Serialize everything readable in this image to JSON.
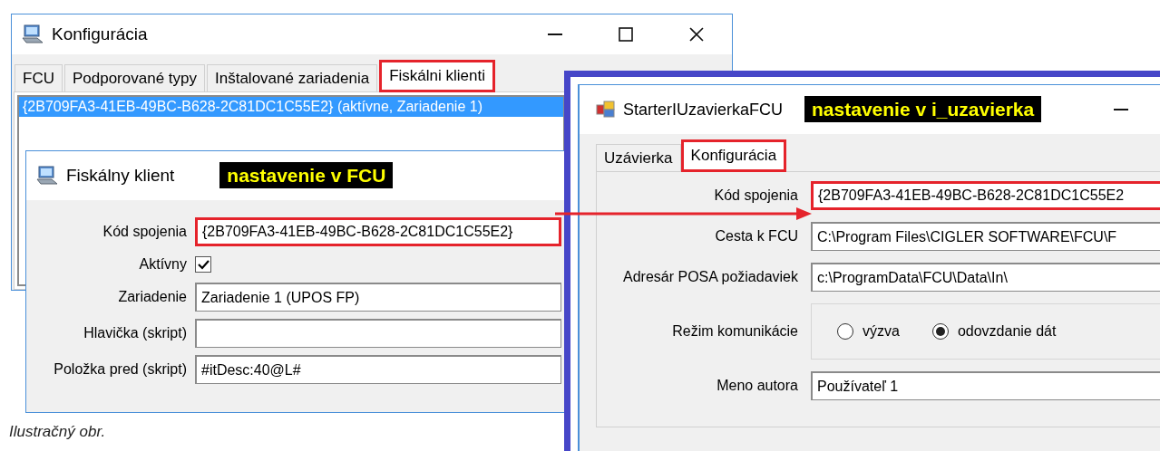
{
  "config_window": {
    "title": "Konfigurácia",
    "tabs": [
      {
        "label": "FCU",
        "selected": false,
        "highlighted": false
      },
      {
        "label": "Podporované typy",
        "selected": false,
        "highlighted": false
      },
      {
        "label": "Inštalované zariadenia",
        "selected": false,
        "highlighted": false
      },
      {
        "label": "Fiskálni klienti",
        "selected": true,
        "highlighted": true
      }
    ],
    "list_items": [
      {
        "text": "{2B709FA3-41EB-49BC-B628-2C81DC1C55E2} (aktívne, Zariadenie 1)",
        "selected": true
      }
    ]
  },
  "client_dialog": {
    "title": "Fiskálny klient",
    "note": "nastavenie v FCU",
    "fields": [
      {
        "kind": "text",
        "label": "Kód spojenia",
        "value": "{2B709FA3-41EB-49BC-B628-2C81DC1C55E2}",
        "highlighted": true
      },
      {
        "kind": "checkbox",
        "label": "Aktívny",
        "checked": true
      },
      {
        "kind": "text",
        "label": "Zariadenie",
        "value": "Zariadenie 1 (UPOS FP)",
        "highlighted": false
      },
      {
        "kind": "text",
        "label": "Hlavička (skript)",
        "highlighted": false
      },
      {
        "kind": "text",
        "label": "Položka pred (skript)",
        "value": "#itDesc:40@L#",
        "highlighted": false
      }
    ]
  },
  "starter_window": {
    "title": "StarterIUzavierkaFCU",
    "note": "nastavenie v i_uzavierka",
    "tabs": [
      {
        "label": "Uzávierka",
        "selected": false,
        "highlighted": false
      },
      {
        "label": "Konfigurácia",
        "selected": true,
        "highlighted": true
      }
    ],
    "fields": [
      {
        "kind": "text",
        "label": "Kód spojenia",
        "value": "{2B709FA3-41EB-49BC-B628-2C81DC1C55E2",
        "highlighted": true
      },
      {
        "kind": "text",
        "label": "Cesta k FCU",
        "value": "C:\\Program Files\\CIGLER SOFTWARE\\FCU\\F",
        "highlighted": false
      },
      {
        "kind": "text",
        "label": "Adresár POSA požiadaviek",
        "value": "c:\\ProgramData\\FCU\\Data\\In\\",
        "highlighted": false
      },
      {
        "kind": "radio",
        "label": "Režim komunikácie",
        "options": [
          {
            "label": "výzva",
            "selected": false
          },
          {
            "label": "odovzdanie dát",
            "selected": true
          }
        ]
      },
      {
        "kind": "text",
        "label": "Meno autora",
        "value": "Používateľ 1",
        "highlighted": false
      }
    ]
  },
  "caption": "Ilustračný obr."
}
